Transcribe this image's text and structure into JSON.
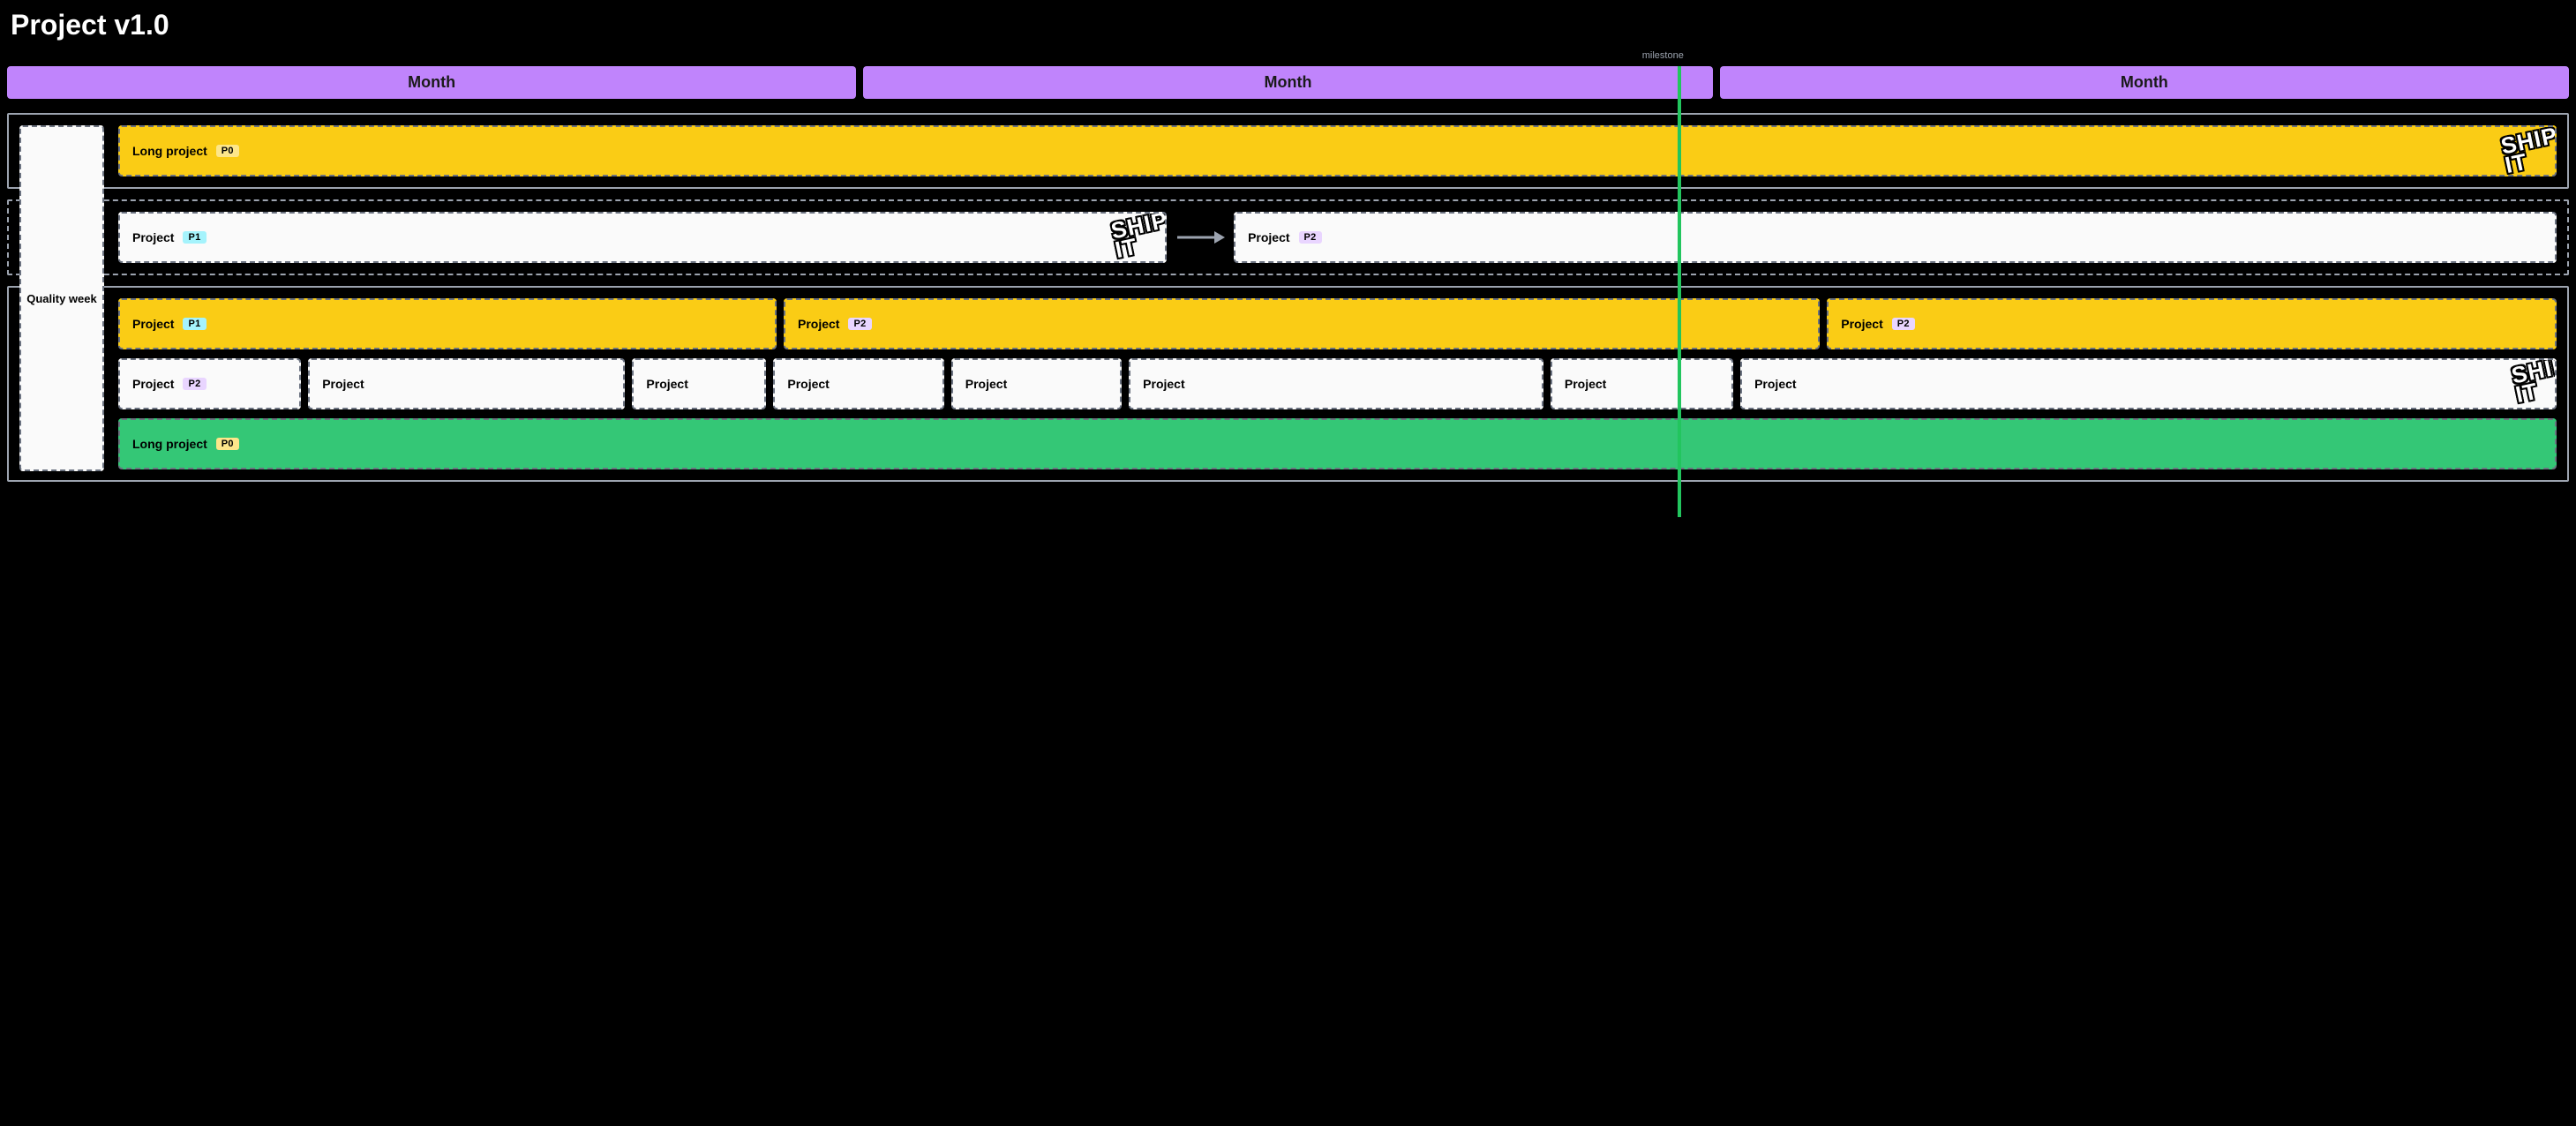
{
  "title": "Project v1.0",
  "milestone": {
    "label": "milestone",
    "position_pct": 65.2
  },
  "months": [
    "Month",
    "Month",
    "Month"
  ],
  "quality_week_label": "Quality week",
  "ship_it_text": "SHIP\nIT",
  "group1": {
    "card": {
      "label": "Long project",
      "prio": "P0"
    }
  },
  "group2": {
    "left": {
      "label": "Project",
      "prio": "P1"
    },
    "right": {
      "label": "Project",
      "prio": "P2"
    }
  },
  "group3": {
    "rowA": [
      {
        "label": "Project",
        "prio": "P1"
      },
      {
        "label": "Project",
        "prio": "P2"
      },
      {
        "label": "Project",
        "prio": "P2"
      }
    ],
    "rowB": [
      {
        "label": "Project",
        "prio": "P2"
      },
      {
        "label": "Project"
      },
      {
        "label": "Project"
      },
      {
        "label": "Project"
      },
      {
        "label": "Project"
      },
      {
        "label": "Project"
      },
      {
        "label": "Project"
      },
      {
        "label": "Project"
      }
    ],
    "rowC": {
      "label": "Long project",
      "prio": "P0"
    }
  }
}
